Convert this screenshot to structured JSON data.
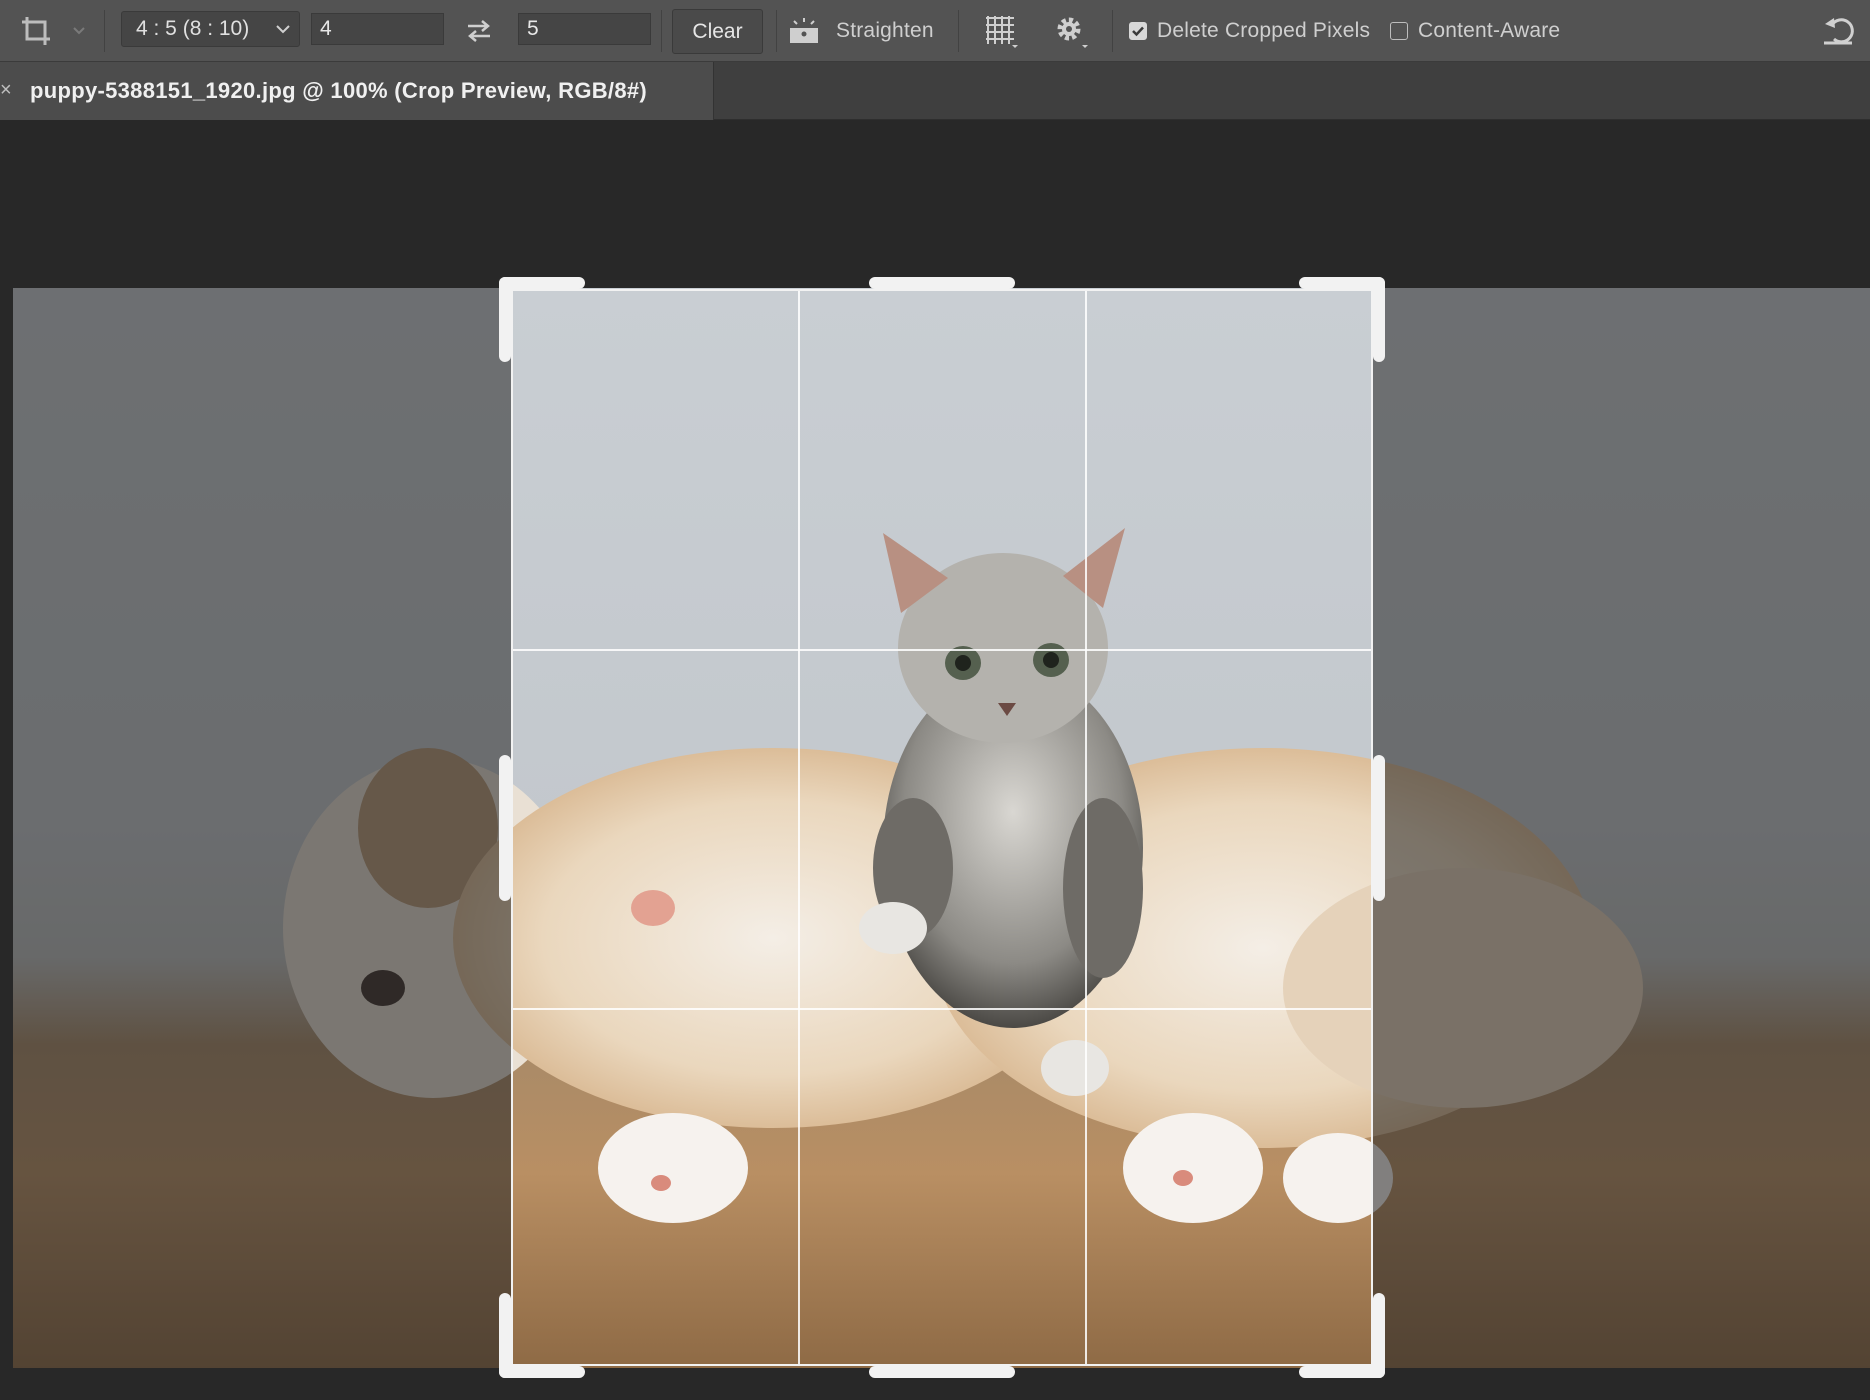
{
  "options_bar": {
    "tool_icon": "crop-icon",
    "ratio_select": {
      "value": "4 : 5 (8 : 10)"
    },
    "width_value": "4",
    "swap_icon": "swap-arrows-icon",
    "height_value": "5",
    "clear_label": "Clear",
    "straighten_icon": "level-icon",
    "straighten_label": "Straighten",
    "overlay_icon": "grid-overlay-icon",
    "settings_icon": "gear-icon",
    "delete_cropped": {
      "label": "Delete Cropped Pixels",
      "checked": true
    },
    "content_aware": {
      "label": "Content-Aware",
      "checked": false
    },
    "reset_icon": "reset-icon"
  },
  "document": {
    "tab_title": "puppy-5388151_1920.jpg @ 100% (Crop Preview, RGB/8#)",
    "close_glyph": "×"
  },
  "crop": {
    "grid": "rule-of-thirds",
    "aspect": "4:5"
  },
  "colors": {
    "options_bar": "#535353",
    "tab_bar": "#3f3f3f",
    "canvas": "#282828",
    "crop_border": "#f2f2f2"
  }
}
